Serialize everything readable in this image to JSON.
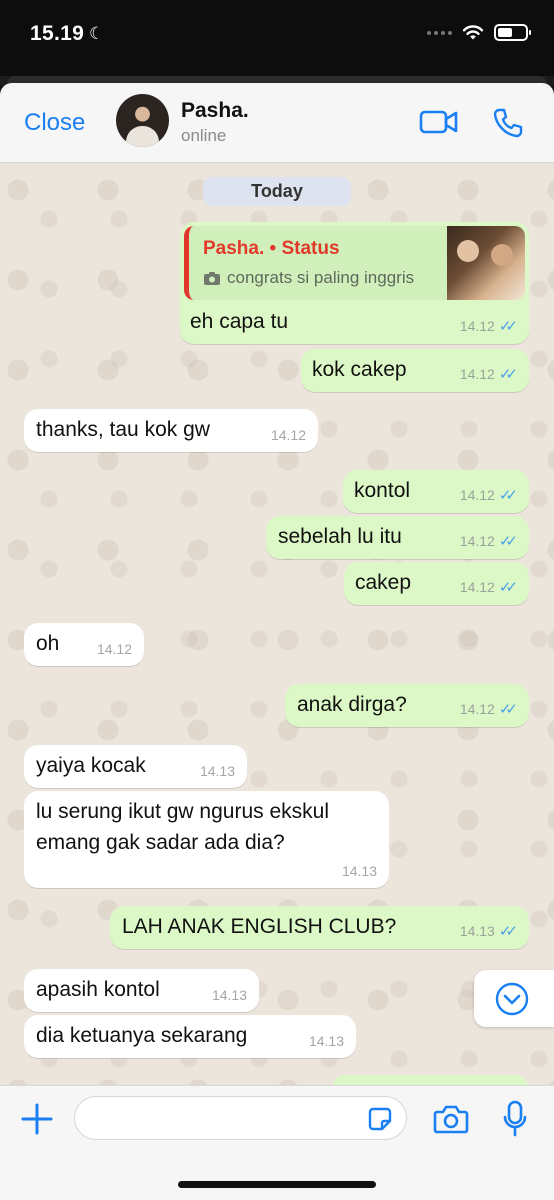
{
  "status_bar": {
    "time": "15.19",
    "moon_glyph": "☾"
  },
  "header": {
    "close_label": "Close",
    "contact_name": "Pasha.",
    "contact_status": "online",
    "video_icon": "video-camera-icon",
    "call_icon": "phone-icon"
  },
  "chat": {
    "day_label": "Today",
    "status_reply": {
      "title": "Pasha. • Status",
      "caption": "congrats si paling inggris",
      "text": "eh capa tu",
      "time": "14.12"
    },
    "messages": [
      {
        "dir": "out",
        "text": "kok cakep",
        "time": "14.12"
      },
      {
        "dir": "in",
        "text": "thanks, tau kok gw",
        "time": "14.12"
      },
      {
        "dir": "out",
        "text": "kontol",
        "time": "14.12"
      },
      {
        "dir": "out",
        "text": "sebelah lu itu",
        "time": "14.12"
      },
      {
        "dir": "out",
        "text": "cakep",
        "time": "14.12"
      },
      {
        "dir": "in",
        "text": "oh",
        "time": "14.12"
      },
      {
        "dir": "out",
        "text": "anak dirga?",
        "time": "14.12"
      },
      {
        "dir": "in",
        "text": "yaiya kocak",
        "time": "14.13"
      },
      {
        "dir": "in",
        "line1": "lu serung ikut gw ngurus ekskul",
        "line2": "emang gak sadar ada dia?",
        "time": "14.13"
      },
      {
        "dir": "out",
        "text": "LAH ANAK ENGLISH CLUB?",
        "time": "14.13"
      },
      {
        "dir": "in",
        "text": "apasih kontol",
        "time": "14.13"
      },
      {
        "dir": "in",
        "text": "dia ketuanya sekarang",
        "time": "14.13"
      }
    ],
    "read_ticks": "✓✓"
  },
  "input": {
    "placeholder": "",
    "value": ""
  },
  "colors": {
    "accent": "#1a7ff0",
    "outgoing": "#dcf8c6",
    "incoming": "#ffffff",
    "status_red": "#e23a2a",
    "ticks": "#4aa3e8"
  }
}
